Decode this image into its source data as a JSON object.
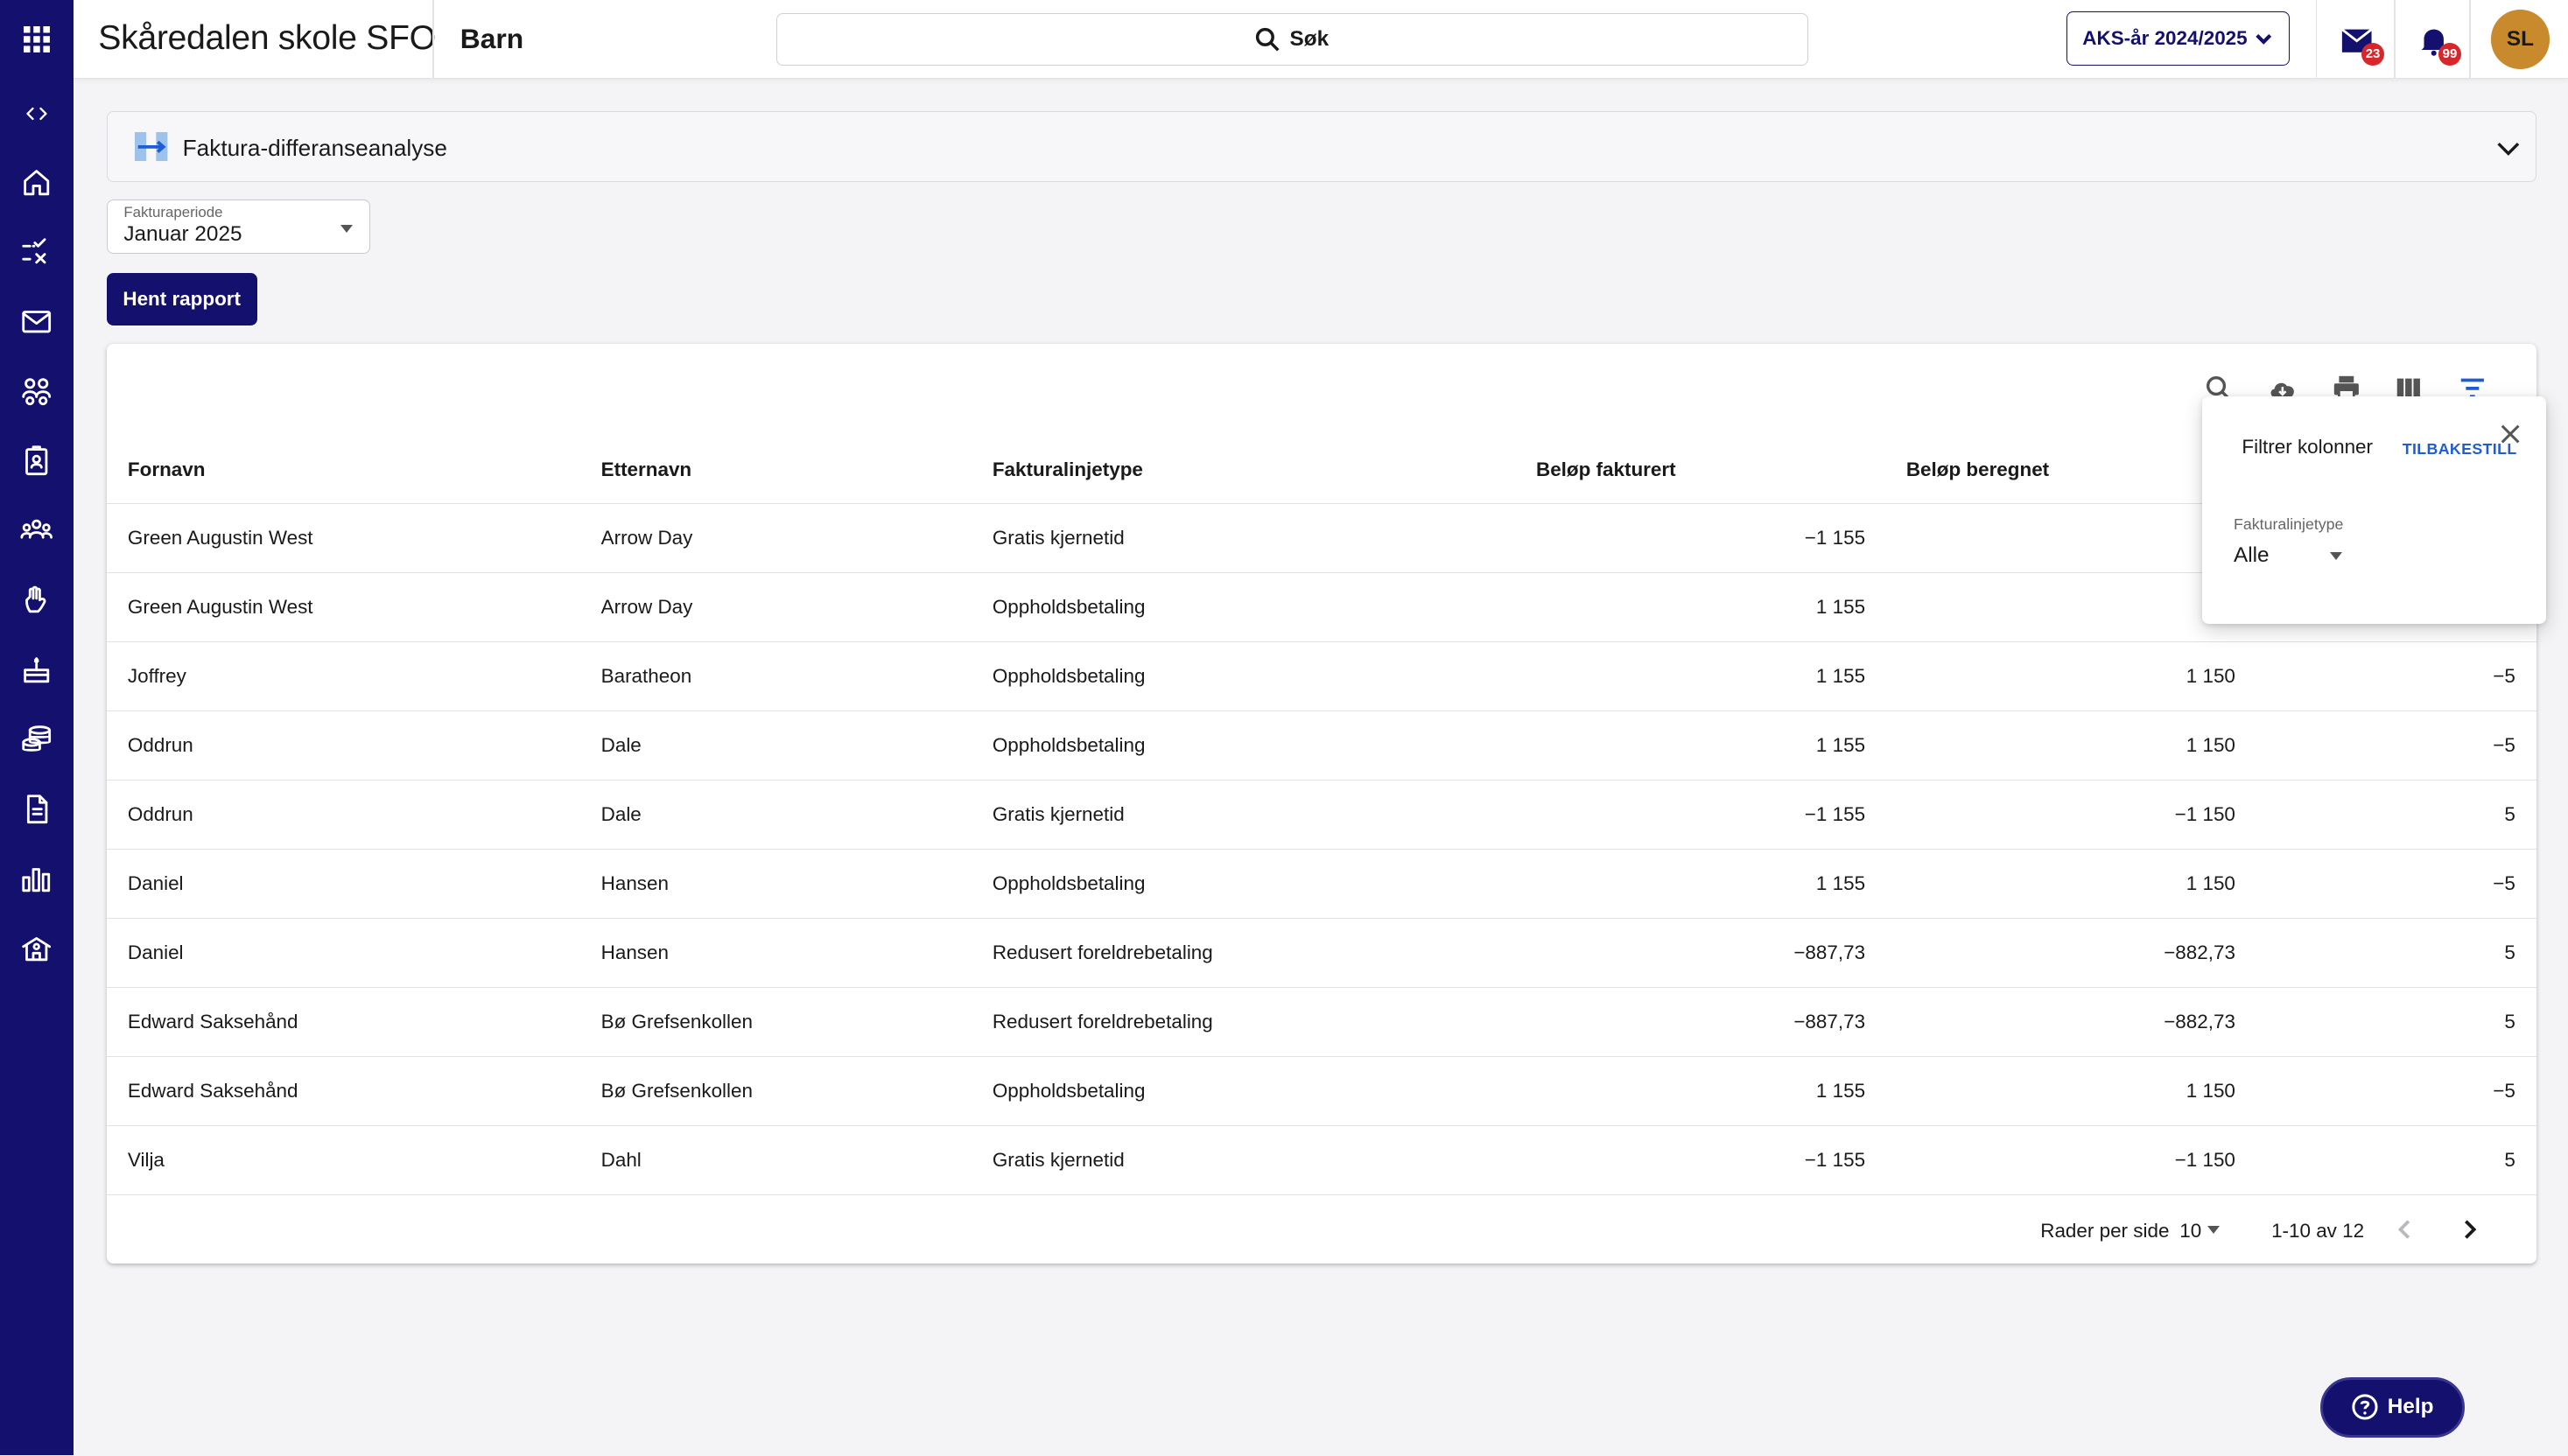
{
  "header": {
    "app_title": "Skåredalen skole SFO",
    "section_title": "Barn",
    "search_label": "Søk",
    "school_year": "AKS-år 2024/2025",
    "messages_badge": "23",
    "notifications_badge": "99",
    "avatar_initials": "SL"
  },
  "sidebar": {
    "items": [
      {
        "icon": "apps-grid-icon"
      },
      {
        "icon": "collapse-toggle-icon"
      },
      {
        "icon": "home-icon"
      },
      {
        "icon": "attendance-checklist-icon"
      },
      {
        "icon": "mail-icon"
      },
      {
        "icon": "children-icon"
      },
      {
        "icon": "badge-icon"
      },
      {
        "icon": "groups-icon"
      },
      {
        "icon": "hand-icon"
      },
      {
        "icon": "cake-icon"
      },
      {
        "icon": "coins-icon"
      },
      {
        "icon": "document-icon"
      },
      {
        "icon": "bar-chart-icon"
      },
      {
        "icon": "school-icon"
      }
    ]
  },
  "report": {
    "title": "Faktura-differanseanalyse",
    "period_label": "Fakturaperiode",
    "period_value": "Januar 2025",
    "fetch_button": "Hent rapport"
  },
  "table": {
    "columns": [
      "Fornavn",
      "Etternavn",
      "Fakturalinjetype",
      "Beløp fakturert",
      "Beløp beregnet"
    ],
    "rows": [
      {
        "first": "Green Augustin West",
        "last": "Arrow Day",
        "type": "Gratis kjernetid",
        "invoiced": "−1 155",
        "calculated": "−1",
        "diff": ""
      },
      {
        "first": "Green Augustin West",
        "last": "Arrow Day",
        "type": "Oppholdsbetaling",
        "invoiced": "1 155",
        "calculated": "1",
        "diff": ""
      },
      {
        "first": "Joffrey",
        "last": "Baratheon",
        "type": "Oppholdsbetaling",
        "invoiced": "1 155",
        "calculated": "1 150",
        "diff": "−5"
      },
      {
        "first": "Oddrun",
        "last": "Dale",
        "type": "Oppholdsbetaling",
        "invoiced": "1 155",
        "calculated": "1 150",
        "diff": "−5"
      },
      {
        "first": "Oddrun",
        "last": "Dale",
        "type": "Gratis kjernetid",
        "invoiced": "−1 155",
        "calculated": "−1 150",
        "diff": "5"
      },
      {
        "first": "Daniel",
        "last": "Hansen",
        "type": "Oppholdsbetaling",
        "invoiced": "1 155",
        "calculated": "1 150",
        "diff": "−5"
      },
      {
        "first": "Daniel",
        "last": "Hansen",
        "type": "Redusert foreldrebetaling",
        "invoiced": "−887,73",
        "calculated": "−882,73",
        "diff": "5"
      },
      {
        "first": "Edward Saksehånd",
        "last": "Bø Grefsenkollen",
        "type": "Redusert foreldrebetaling",
        "invoiced": "−887,73",
        "calculated": "−882,73",
        "diff": "5"
      },
      {
        "first": "Edward Saksehånd",
        "last": "Bø Grefsenkollen",
        "type": "Oppholdsbetaling",
        "invoiced": "1 155",
        "calculated": "1 150",
        "diff": "−5"
      },
      {
        "first": "Vilja",
        "last": "Dahl",
        "type": "Gratis kjernetid",
        "invoiced": "−1 155",
        "calculated": "−1 150",
        "diff": "5"
      }
    ],
    "pagination": {
      "rows_per_page_label": "Rader per side",
      "rows_per_page": "10",
      "range": "1-10 av 12"
    }
  },
  "filter_popover": {
    "title": "Filtrer kolonner",
    "reset": "TILBAKESTILL",
    "field_label": "Fakturalinjetype",
    "field_value": "Alle"
  },
  "help": {
    "label": "Help"
  },
  "colors": {
    "brand_navy": "#14106e",
    "badge_red": "#d9262b",
    "avatar_orange": "#c98a2e",
    "link_blue": "#1e5dd6"
  }
}
